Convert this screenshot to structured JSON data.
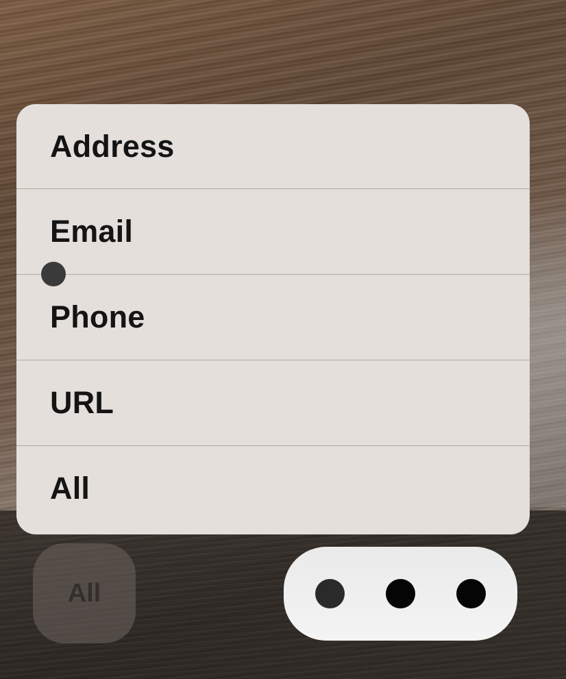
{
  "menu": {
    "items": [
      {
        "label": "Address"
      },
      {
        "label": "Email"
      },
      {
        "label": "Phone"
      },
      {
        "label": "URL"
      },
      {
        "label": "All"
      }
    ]
  },
  "bottom_bar": {
    "filter_button_label": "All",
    "more_button_icon": "ellipsis-icon"
  },
  "colors": {
    "menu_background": "#e4dfda",
    "menu_divider": "#b8a89f",
    "text": "#141414"
  }
}
